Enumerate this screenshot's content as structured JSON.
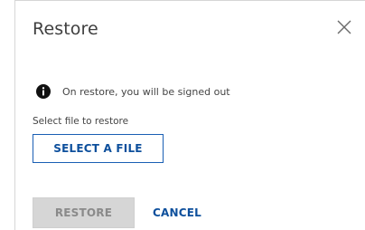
{
  "dialog": {
    "title": "Restore",
    "close_icon": "close-icon",
    "notice": {
      "icon": "info-icon",
      "text": "On restore, you will be signed out"
    },
    "file_label": "Select file to restore",
    "select_file_button": "SELECT A FILE",
    "restore_button": "RESTORE",
    "restore_button_state": "disabled",
    "cancel_button": "CANCEL"
  },
  "colors": {
    "accent": "#0d4f9c",
    "disabled_bg": "#d6d6d6",
    "disabled_text": "#8a8a8a",
    "text": "#444444"
  }
}
